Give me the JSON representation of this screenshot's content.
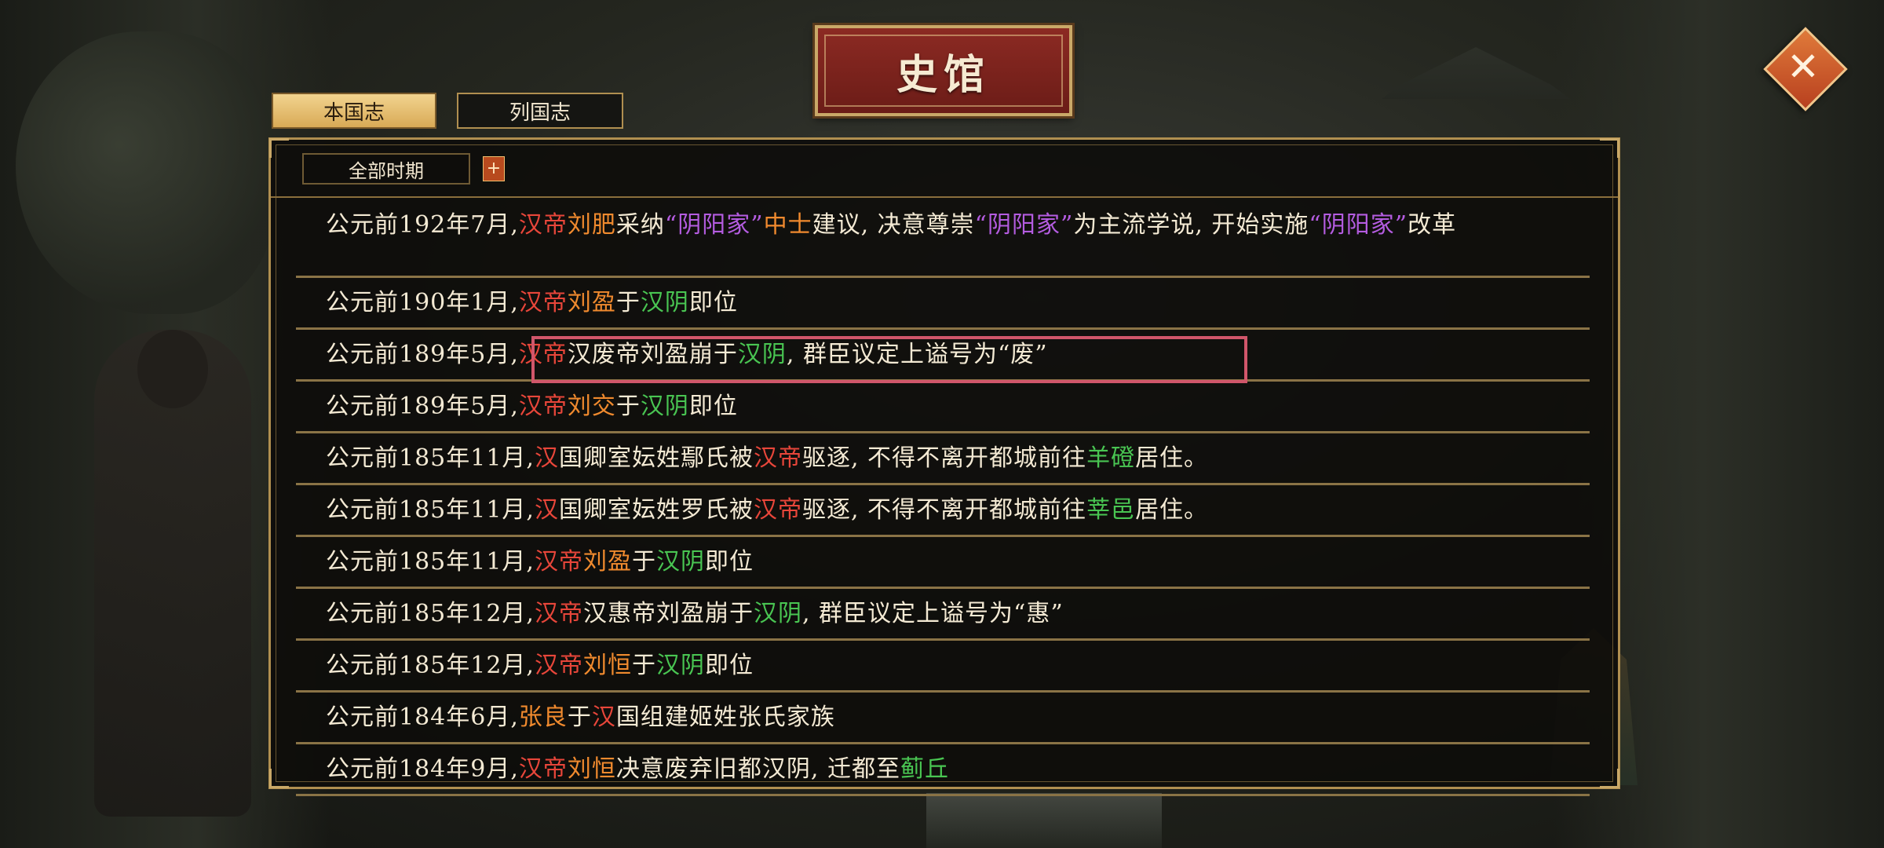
{
  "title": "史馆",
  "close_glyph": "✕",
  "tabs": [
    {
      "label": "本国志",
      "active": true
    },
    {
      "label": "列国志",
      "active": false
    }
  ],
  "filter": {
    "selected": "全部时期",
    "plus": "+"
  },
  "colors": {
    "white": "#f4ead4",
    "red": "#e8463a",
    "orange": "#f08a2e",
    "green": "#49c552",
    "purple": "#b45ce0",
    "highlight": "#d0566a"
  },
  "entries": [
    {
      "rows": 2,
      "segments": [
        {
          "t": "公元前192年7月,",
          "c": "white"
        },
        {
          "t": "汉帝",
          "c": "red"
        },
        {
          "t": "刘肥",
          "c": "orange"
        },
        {
          "t": "采纳",
          "c": "white"
        },
        {
          "t": "“阴阳家”",
          "c": "purple"
        },
        {
          "t": "中士",
          "c": "orange"
        },
        {
          "t": "建议, 决意尊崇",
          "c": "white"
        },
        {
          "t": "“阴阳家”",
          "c": "purple"
        },
        {
          "t": "为主流学说, 开始实施",
          "c": "white"
        },
        {
          "t": "“阴阳家”",
          "c": "purple"
        },
        {
          "t": "改革",
          "c": "white"
        }
      ]
    },
    {
      "rows": 1,
      "segments": [
        {
          "t": "公元前190年1月,",
          "c": "white"
        },
        {
          "t": "汉帝",
          "c": "red"
        },
        {
          "t": "刘盈",
          "c": "orange"
        },
        {
          "t": "于",
          "c": "white"
        },
        {
          "t": "汉阴",
          "c": "green"
        },
        {
          "t": "即位",
          "c": "white"
        }
      ]
    },
    {
      "rows": 1,
      "segments": [
        {
          "t": "公元前189年5月,",
          "c": "white"
        },
        {
          "t": "汉帝",
          "c": "red"
        },
        {
          "t": "汉废帝刘盈崩于",
          "c": "white"
        },
        {
          "t": "汉阴",
          "c": "green"
        },
        {
          "t": ", 群臣议定上谥号为“废”",
          "c": "white"
        }
      ]
    },
    {
      "rows": 1,
      "segments": [
        {
          "t": "公元前189年5月,",
          "c": "white"
        },
        {
          "t": "汉帝",
          "c": "red"
        },
        {
          "t": "刘交",
          "c": "orange"
        },
        {
          "t": "于",
          "c": "white"
        },
        {
          "t": "汉阴",
          "c": "green"
        },
        {
          "t": "即位",
          "c": "white"
        }
      ]
    },
    {
      "rows": 1,
      "segments": [
        {
          "t": "公元前185年11月,",
          "c": "white"
        },
        {
          "t": "汉",
          "c": "red"
        },
        {
          "t": "国卿室妘姓鄢氏被",
          "c": "white"
        },
        {
          "t": "汉帝",
          "c": "red"
        },
        {
          "t": "驱逐, 不得不离开都城前往",
          "c": "white"
        },
        {
          "t": "羊磴",
          "c": "green"
        },
        {
          "t": "居住。",
          "c": "white"
        }
      ]
    },
    {
      "rows": 1,
      "segments": [
        {
          "t": "公元前185年11月,",
          "c": "white"
        },
        {
          "t": "汉",
          "c": "red"
        },
        {
          "t": "国卿室妘姓罗氏被",
          "c": "white"
        },
        {
          "t": "汉帝",
          "c": "red"
        },
        {
          "t": "驱逐, 不得不离开都城前往",
          "c": "white"
        },
        {
          "t": "莘邑",
          "c": "green"
        },
        {
          "t": "居住。",
          "c": "white"
        }
      ]
    },
    {
      "rows": 1,
      "segments": [
        {
          "t": "公元前185年11月,",
          "c": "white"
        },
        {
          "t": "汉帝",
          "c": "red"
        },
        {
          "t": "刘盈",
          "c": "orange"
        },
        {
          "t": "于",
          "c": "white"
        },
        {
          "t": "汉阴",
          "c": "green"
        },
        {
          "t": "即位",
          "c": "white"
        }
      ]
    },
    {
      "rows": 1,
      "segments": [
        {
          "t": "公元前185年12月,",
          "c": "white"
        },
        {
          "t": "汉帝",
          "c": "red"
        },
        {
          "t": "汉惠帝刘盈崩于",
          "c": "white"
        },
        {
          "t": "汉阴",
          "c": "green"
        },
        {
          "t": ", 群臣议定上谥号为“惠”",
          "c": "white"
        }
      ]
    },
    {
      "rows": 1,
      "segments": [
        {
          "t": "公元前185年12月,",
          "c": "white"
        },
        {
          "t": "汉帝",
          "c": "red"
        },
        {
          "t": "刘恒",
          "c": "orange"
        },
        {
          "t": "于",
          "c": "white"
        },
        {
          "t": "汉阴",
          "c": "green"
        },
        {
          "t": "即位",
          "c": "white"
        }
      ]
    },
    {
      "rows": 1,
      "segments": [
        {
          "t": "公元前184年6月,",
          "c": "white"
        },
        {
          "t": "张良",
          "c": "orange"
        },
        {
          "t": "于",
          "c": "white"
        },
        {
          "t": "汉",
          "c": "red"
        },
        {
          "t": "国组建姬姓张氏家族",
          "c": "white"
        }
      ]
    },
    {
      "rows": 1,
      "segments": [
        {
          "t": "公元前184年9月,",
          "c": "white"
        },
        {
          "t": "汉帝",
          "c": "red"
        },
        {
          "t": "刘恒",
          "c": "orange"
        },
        {
          "t": "决意废弃旧都汉阴, 迁都至",
          "c": "white"
        },
        {
          "t": "蓟丘",
          "c": "green"
        }
      ]
    }
  ]
}
